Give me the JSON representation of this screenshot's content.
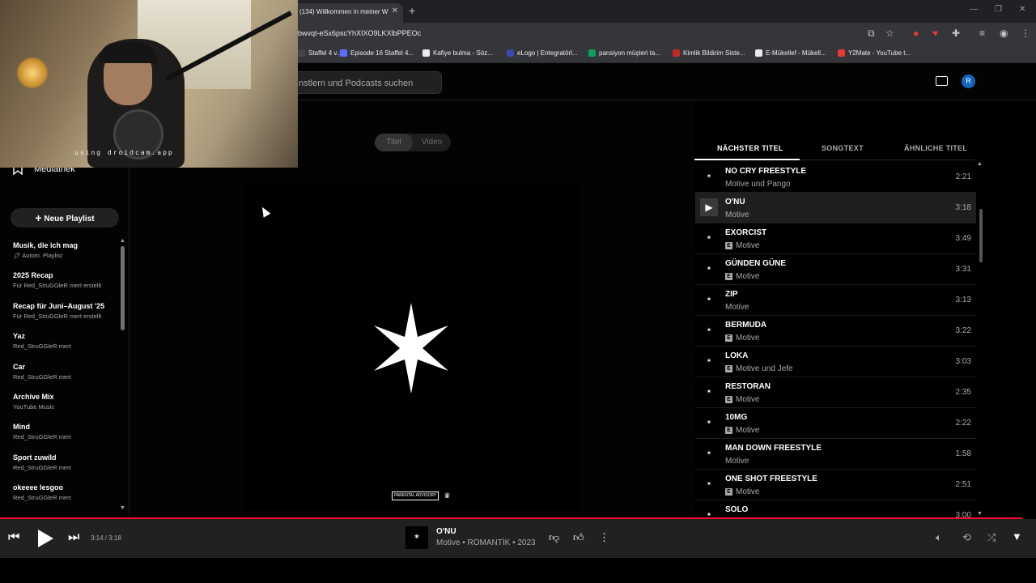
{
  "browser": {
    "tab_title": "(134) Willkommen in meiner W",
    "url": "bwvqt-eSx6pscYhXIXO9LKXlbPPEOc",
    "bookmarks": [
      {
        "label": "Staffel 4 v...",
        "color": "#444"
      },
      {
        "label": "Episode 16 Staffel 4...",
        "color": "#5b6cff"
      },
      {
        "label": "Kafiye bulma - Söz...",
        "color": "#e8eaed"
      },
      {
        "label": "eLogo | Entegratörl...",
        "color": "#3949ab"
      },
      {
        "label": "pansiyon müşteri ta...",
        "color": "#0f9d58"
      },
      {
        "label": "Kimlik Bildirim Siste...",
        "color": "#c62828"
      },
      {
        "label": "E-Mükellef - Mükell...",
        "color": "#e8eaed"
      },
      {
        "label": "Y2Mate - YouTube t...",
        "color": "#e53935"
      }
    ]
  },
  "webcam": {
    "overlay_text": "using droidcam.app"
  },
  "header": {
    "search_placeholder": "nstlern und Podcasts suchen",
    "avatar_letter": "R"
  },
  "sidebar": {
    "library_label": "Mediathek",
    "new_playlist_label": "Neue Playlist",
    "playlists": [
      {
        "title": "Musik, die ich mag",
        "subtitle": "Autom. Playlist"
      },
      {
        "title": "2025 Recap",
        "subtitle": "Für Red_StruGGleR mert erstellt"
      },
      {
        "title": "Recap für Juni–August '25",
        "subtitle": "Für Red_StruGGleR mert erstellt"
      },
      {
        "title": "Yaz",
        "subtitle": "Red_StruGGleR mert"
      },
      {
        "title": "Car",
        "subtitle": "Red_StruGGleR mert"
      },
      {
        "title": "Archive Mix",
        "subtitle": "YouTube Music"
      },
      {
        "title": "Mind",
        "subtitle": "Red_StruGGleR mert"
      },
      {
        "title": "Sport zuwild",
        "subtitle": "Red_StruGGleR mert"
      },
      {
        "title": "okeeee lesgoo",
        "subtitle": "Red_StruGGleR mert"
      }
    ]
  },
  "main": {
    "toggle": {
      "song": "Titel",
      "video": "Video"
    },
    "parental_advisory": "PARENTAL ADVISORY"
  },
  "queue": {
    "tabs": [
      "NÄCHSTER TITEL",
      "SONGTEXT",
      "ÄHNLICHE TITEL"
    ],
    "items": [
      {
        "title": "NO CRY FREESTYLE",
        "artist": "Motive und Pango",
        "duration": "2:21",
        "explicit": false,
        "playing": false
      },
      {
        "title": "O'NU",
        "artist": "Motive",
        "duration": "3:18",
        "explicit": false,
        "playing": true
      },
      {
        "title": "EXORCIST",
        "artist": "Motive",
        "duration": "3:49",
        "explicit": true,
        "playing": false
      },
      {
        "title": "GÜNDEN GÜNE",
        "artist": "Motive",
        "duration": "3:31",
        "explicit": true,
        "playing": false
      },
      {
        "title": "ZIP",
        "artist": "Motive",
        "duration": "3:13",
        "explicit": false,
        "playing": false
      },
      {
        "title": "BERMUDA",
        "artist": "Motive",
        "duration": "3:22",
        "explicit": true,
        "playing": false
      },
      {
        "title": "LOKA",
        "artist": "Motive und Jefe",
        "duration": "3:03",
        "explicit": true,
        "playing": false
      },
      {
        "title": "RESTORAN",
        "artist": "Motive",
        "duration": "2:35",
        "explicit": true,
        "playing": false
      },
      {
        "title": "10MG",
        "artist": "Motive",
        "duration": "2:22",
        "explicit": true,
        "playing": false
      },
      {
        "title": "MAN DOWN FREESTYLE",
        "artist": "Motive",
        "duration": "1:58",
        "explicit": false,
        "playing": false
      },
      {
        "title": "ONE SHOT FREESTYLE",
        "artist": "Motive",
        "duration": "2:51",
        "explicit": true,
        "playing": false
      },
      {
        "title": "SOLO",
        "artist": "",
        "duration": "3:00",
        "explicit": false,
        "playing": false
      }
    ]
  },
  "player": {
    "time": "3:14 / 3:18",
    "title": "O'NU",
    "subtitle": "Motive • ROMANTİK • 2023",
    "progress_fraction": 0.987,
    "accent_color": "#ff0033"
  }
}
